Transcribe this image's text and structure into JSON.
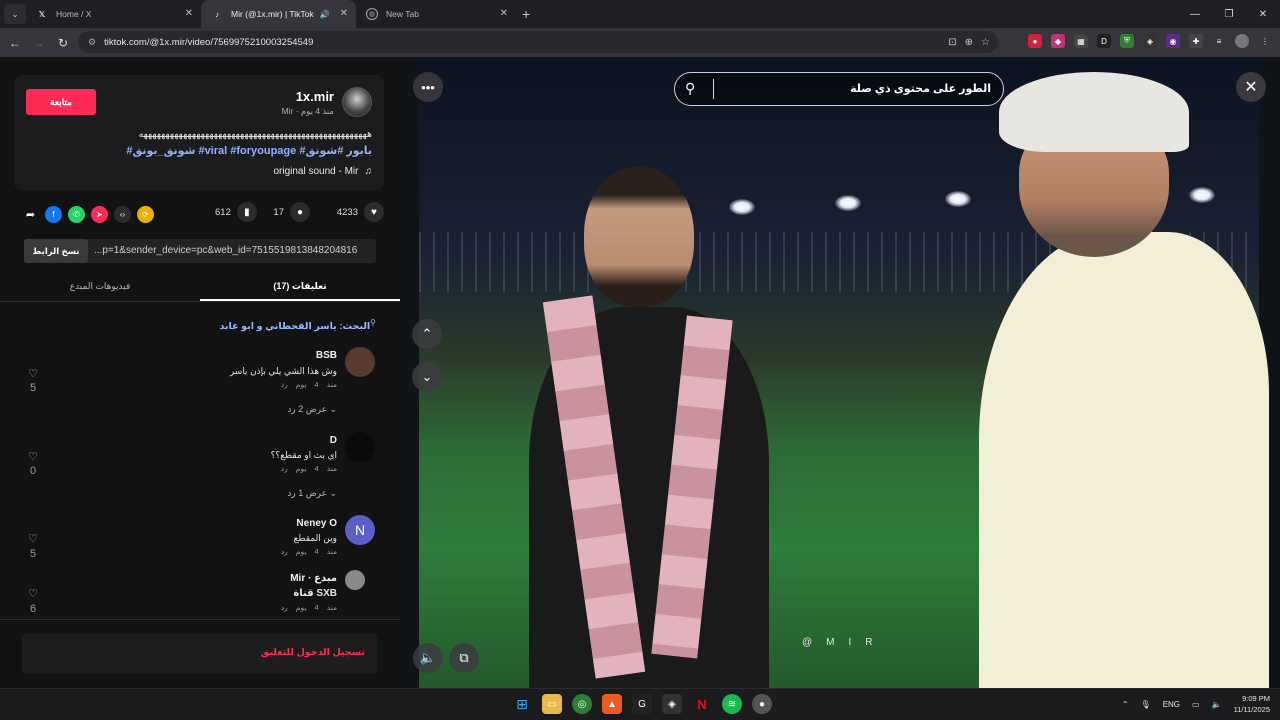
{
  "browser": {
    "tabs": [
      {
        "title": "Home / X",
        "icon": "x-logo-icon",
        "active": false
      },
      {
        "title": "Mir (@1x.mir) | TikTok",
        "icon": "tiktok-logo-icon",
        "active": true
      },
      {
        "title": "New Tab",
        "icon": "globe-icon",
        "active": false
      }
    ],
    "new_tab_label": "+",
    "url": "tiktok.com/@1x.mir/video/7569975210003254549"
  },
  "post": {
    "display_name": "1x.mir",
    "subline": "Mir · منذ 4 يوم",
    "follow_label": "متابعة",
    "caption": "ههههههههههههههههههههههههههههههههههههههههههههههههههههه",
    "hashtags": "#شونق_بونق #viral #foryoupage #بابور #شونق",
    "sound": "original sound - Mir",
    "likes": "4233",
    "comments": "17",
    "saves": "612",
    "link_url": "...p=1&sender_device=pc&web_id=7515519813848204816",
    "copy_link_label": "نسخ الرابط",
    "tab_comments": "تعليقات (17)",
    "tab_creator_videos": "فيديوهات المبدع",
    "search_line": "البحث: ياسر القحطاني و ابو عابد"
  },
  "comments": [
    {
      "name": "BSB",
      "text": "وش هذا الشي يلي بإذن ياسر",
      "meta": "منذ 4 يوم  رد",
      "likes": "5",
      "replies": "عرض 2 رد",
      "avatar_color": "#5a3a30",
      "avatar_letter": ""
    },
    {
      "name": "D",
      "text": "اي بث او مقطع؟؟",
      "meta": "منذ 4 يوم  رد",
      "likes": "0",
      "replies": "عرض 1 رد",
      "avatar_color": "#0a0a0a",
      "avatar_letter": ""
    },
    {
      "name": "Neney O",
      "text": "وين المقطع",
      "meta": "منذ 4 يوم  رد",
      "likes": "5",
      "replies": "",
      "avatar_color": "#5b5fc7",
      "avatar_letter": "N"
    },
    {
      "name": "Mir · مبدع",
      "text": "قناة SXB",
      "meta": "منذ 4 يوم  رد",
      "likes": "6",
      "replies": "",
      "avatar_color": "#8a8a8a",
      "avatar_letter": ""
    }
  ],
  "login_prompt": "تسجيل الدخول للتعليق",
  "video": {
    "search_query": "الطور على محتوى ذي صلة",
    "watermark": "@MIR"
  },
  "taskbar": {
    "lang": "ENG",
    "time": "9:09 PM",
    "date": "11/11/2025"
  }
}
